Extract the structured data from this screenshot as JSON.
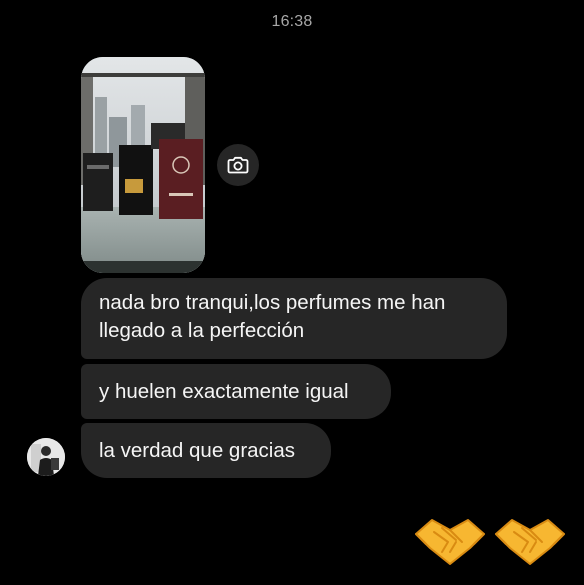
{
  "chat": {
    "timestamp": "16:38",
    "messages": [
      {
        "text": "nada bro tranqui,los perfumes me han\nllegado a la perfección"
      },
      {
        "text": "y huelen exactamente igual"
      },
      {
        "text": "la verdad que gracias"
      }
    ],
    "photo_icon": "camera-icon",
    "sent_reactions": [
      "handshake-emoji",
      "handshake-emoji"
    ]
  },
  "colors": {
    "background": "#000000",
    "bubble": "#262626",
    "timestamp": "#a8a8a8",
    "text": "#f5f5f5"
  }
}
